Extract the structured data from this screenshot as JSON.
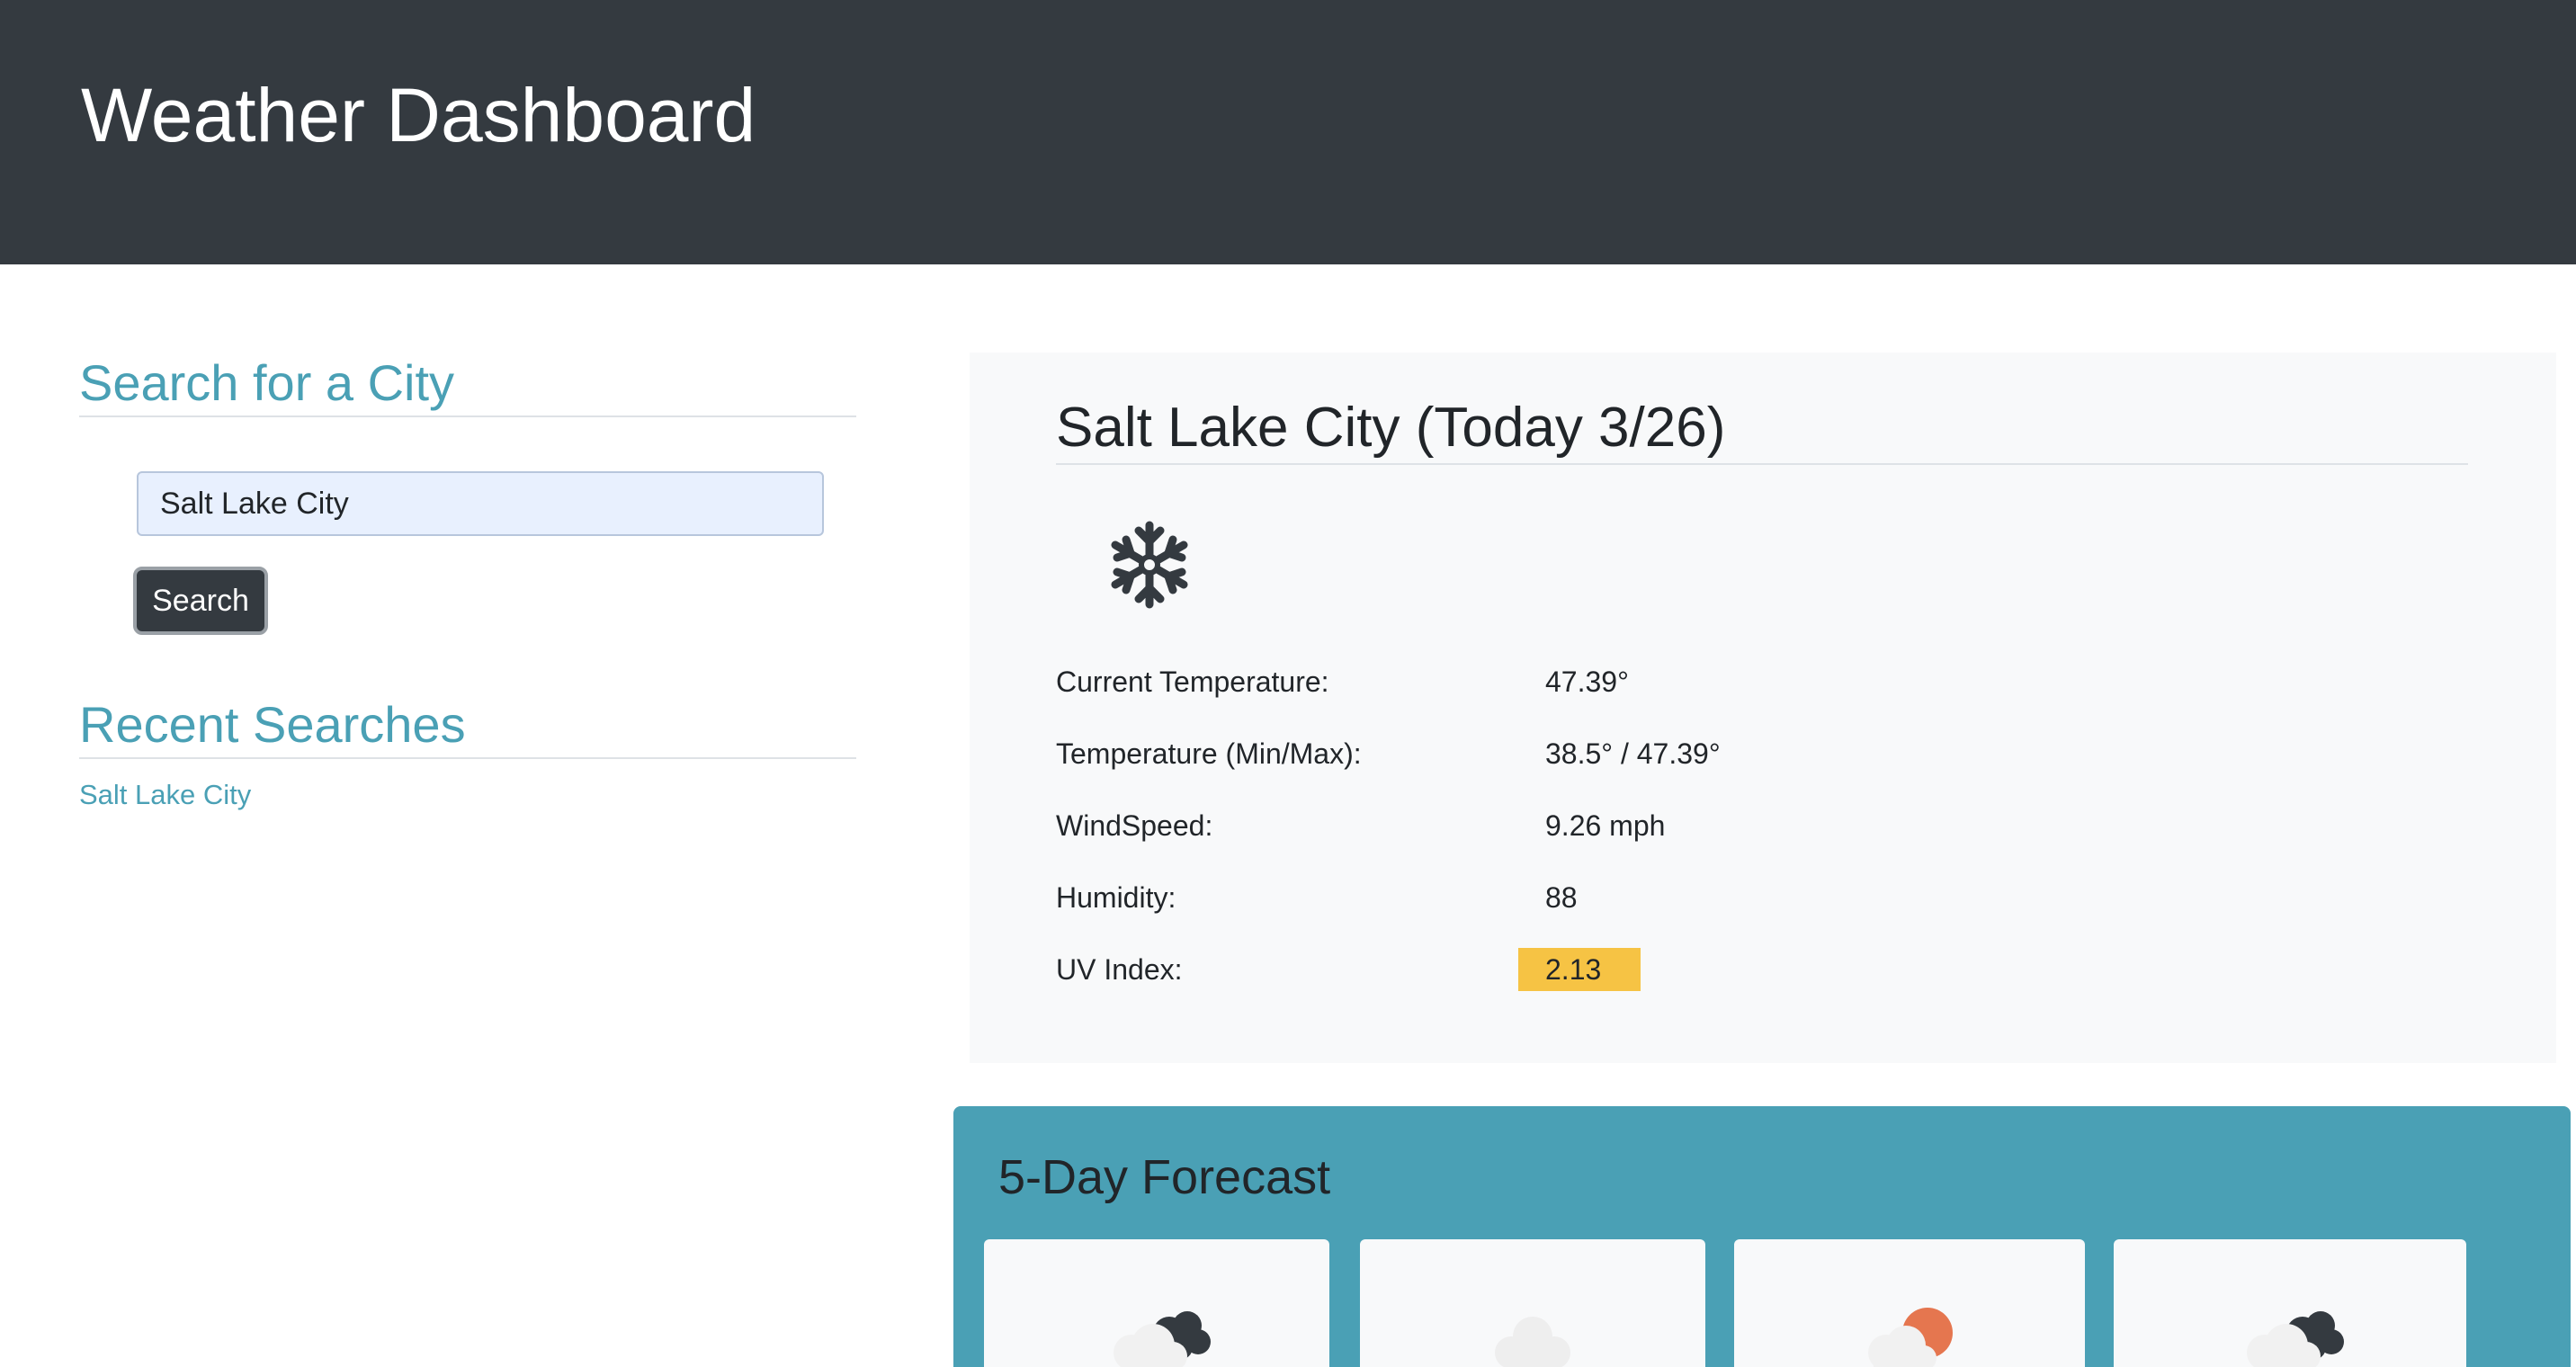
{
  "header": {
    "title": "Weather Dashboard"
  },
  "sidebar": {
    "search_heading": "Search for a City",
    "search_value": "Salt Lake City",
    "search_button_label": "Search",
    "recent_heading": "Recent Searches",
    "recent_items": [
      {
        "label": "Salt Lake City"
      }
    ]
  },
  "current": {
    "title": "Salt Lake City (Today 3/26)",
    "icon": "snowflake-icon",
    "stats": {
      "temp_label": "Current Temperature:",
      "temp_value": "47.39°",
      "minmax_label": "Temperature (Min/Max):",
      "minmax_value": "38.5° / 47.39°",
      "wind_label": "WindSpeed:",
      "wind_value": "9.26 mph",
      "humidity_label": "Humidity:",
      "humidity_value": "88",
      "uv_label": "UV Index:",
      "uv_value": "2.13"
    },
    "uv_color": "#f6c344"
  },
  "forecast": {
    "title": "5-Day Forecast",
    "days": [
      {
        "icon": "rain-cloud-icon"
      },
      {
        "icon": "cloud-icon"
      },
      {
        "icon": "sun-cloud-icon"
      },
      {
        "icon": "rain-cloud-icon"
      }
    ]
  },
  "colors": {
    "header_bg": "#343a40",
    "accent": "#4aa0b5",
    "panel_bg": "#f8f9fa",
    "button_bg": "#343a40"
  }
}
